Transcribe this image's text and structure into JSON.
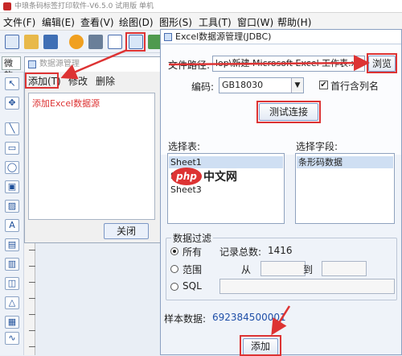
{
  "app": {
    "title": "中琅条码标签打印软件-V6.5.0 试用版 单机",
    "menu": [
      "文件(F)",
      "编辑(E)",
      "查看(V)",
      "绘图(D)",
      "图形(S)",
      "工具(T)",
      "窗口(W)",
      "帮助(H)"
    ],
    "font_select": "微软"
  },
  "tools": [
    "↖",
    "✥",
    "╲",
    "▭",
    "◯",
    "▣",
    "▨",
    "A",
    "▤",
    "▥",
    "◫",
    "△",
    "▦",
    "∿",
    "▧"
  ],
  "datasource_list": {
    "title": "数据源管理",
    "menu": {
      "add": "添加(T)",
      "edit": "修改",
      "delete": "删除"
    },
    "annotation": "添加Excel数据源",
    "close_label": "关闭"
  },
  "jdbc_dialog": {
    "title": "Excel数据源管理(JDBC)",
    "file_path_label": "文件路径:",
    "file_path_value": "lop\\新建 Microsoft Excel 工作表.xls",
    "browse_label": "浏览",
    "encoding_label": "编码:",
    "encoding_value": "GB18030",
    "header_checkbox_label": "首行含列名",
    "header_checked": true,
    "test_connection_label": "测试连接",
    "select_table_label": "选择表:",
    "tables": [
      "Sheet1",
      "Sheet2",
      "Sheet3"
    ],
    "selected_table": "Sheet1",
    "select_field_label": "选择字段:",
    "fields": [
      "条形码数据"
    ],
    "filter_group_label": "数据过滤",
    "filter_all_label": "所有",
    "record_count_label": "记录总数:",
    "record_count_value": "1416",
    "filter_range_label": "范围",
    "range_from_label": "从",
    "range_to_label": "到",
    "filter_sql_label": "SQL",
    "sample_label": "样本数据:",
    "sample_value": "692384500001",
    "add_label": "添加"
  },
  "watermark": {
    "php": "php",
    "cn": "中文网"
  },
  "colors": {
    "highlight_red": "#d33333",
    "sample_blue": "#1f4fa8",
    "annotation_red": "#d33333"
  }
}
